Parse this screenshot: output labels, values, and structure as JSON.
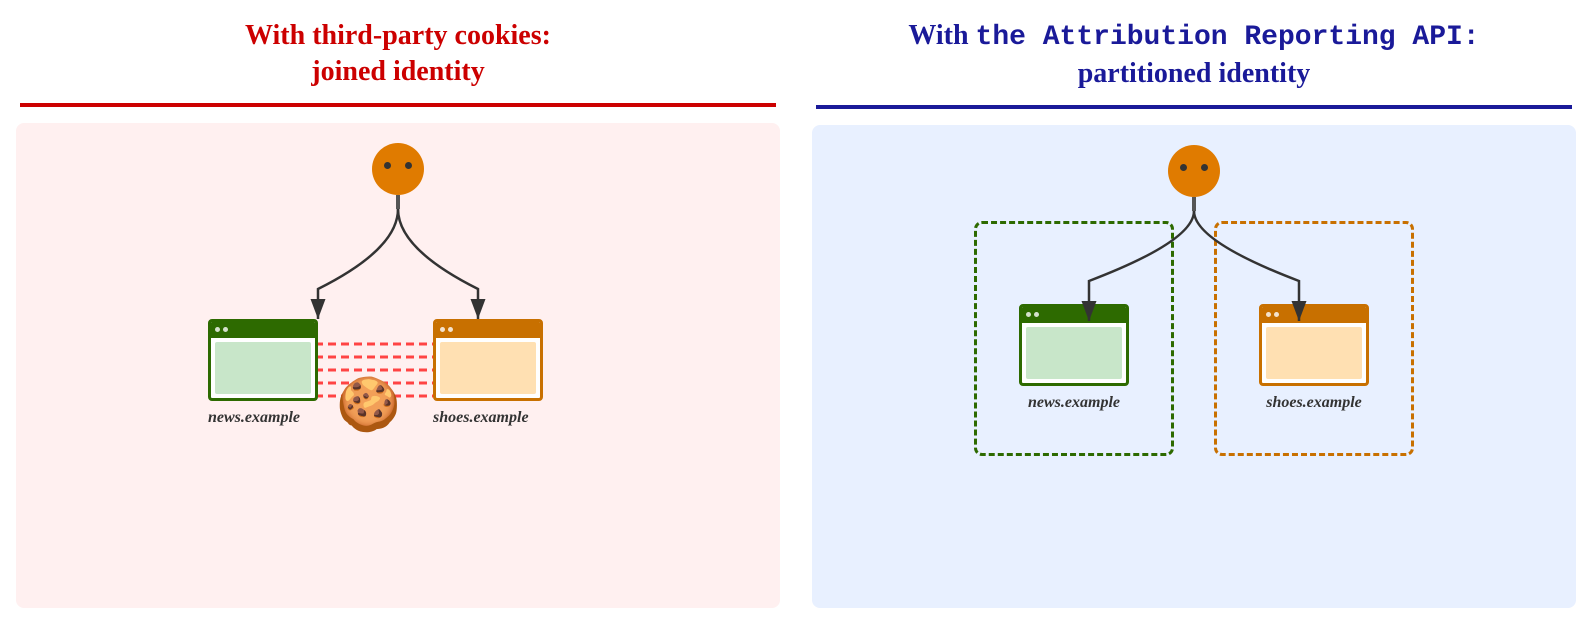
{
  "left": {
    "title_line1": "With third-party cookies:",
    "title_line2": "joined identity",
    "bg_color": "#fff0f0",
    "title_color": "#cc0000",
    "divider_color": "#cc0000",
    "domain1": "news.example",
    "domain2": "shoes.example"
  },
  "right": {
    "title_line1": "With the Attribution Reporting API:",
    "title_line2": "partitioned identity",
    "bg_color": "#e8f0ff",
    "title_color": "#1a1a99",
    "divider_color": "#1a1a99",
    "domain1": "news.example",
    "domain2": "shoes.example"
  }
}
